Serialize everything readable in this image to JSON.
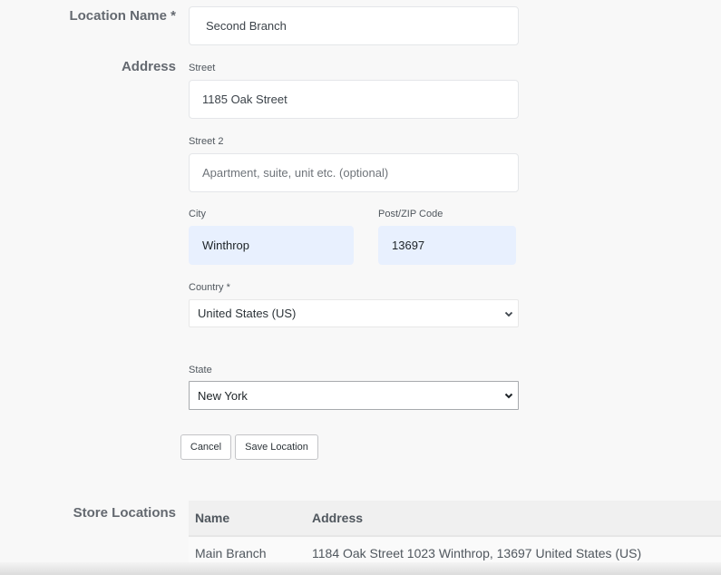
{
  "form": {
    "location_name": {
      "label": "Location Name *",
      "value": "Second Branch"
    },
    "address": {
      "label": "Address",
      "street": {
        "label": "Street",
        "value": "1185 Oak Street"
      },
      "street2": {
        "label": "Street 2",
        "value": "",
        "placeholder": "Apartment, suite, unit etc. (optional)"
      },
      "city": {
        "label": "City",
        "value": "Winthrop"
      },
      "postcode": {
        "label": "Post/ZIP Code",
        "value": "13697"
      },
      "country": {
        "label": "Country *",
        "selected": "United States (US)",
        "icon": "chevron-down-icon"
      },
      "state": {
        "label": "State",
        "selected": "New York",
        "icon": "chevron-down-icon"
      }
    },
    "buttons": {
      "cancel": "Cancel",
      "save": "Save Location"
    }
  },
  "store_locations": {
    "label": "Store Locations",
    "columns": [
      "Name",
      "Address"
    ],
    "rows": [
      {
        "name": "Main Branch",
        "address": "1184 Oak Street 1023 Winthrop, 13697 United States (US)"
      }
    ]
  }
}
